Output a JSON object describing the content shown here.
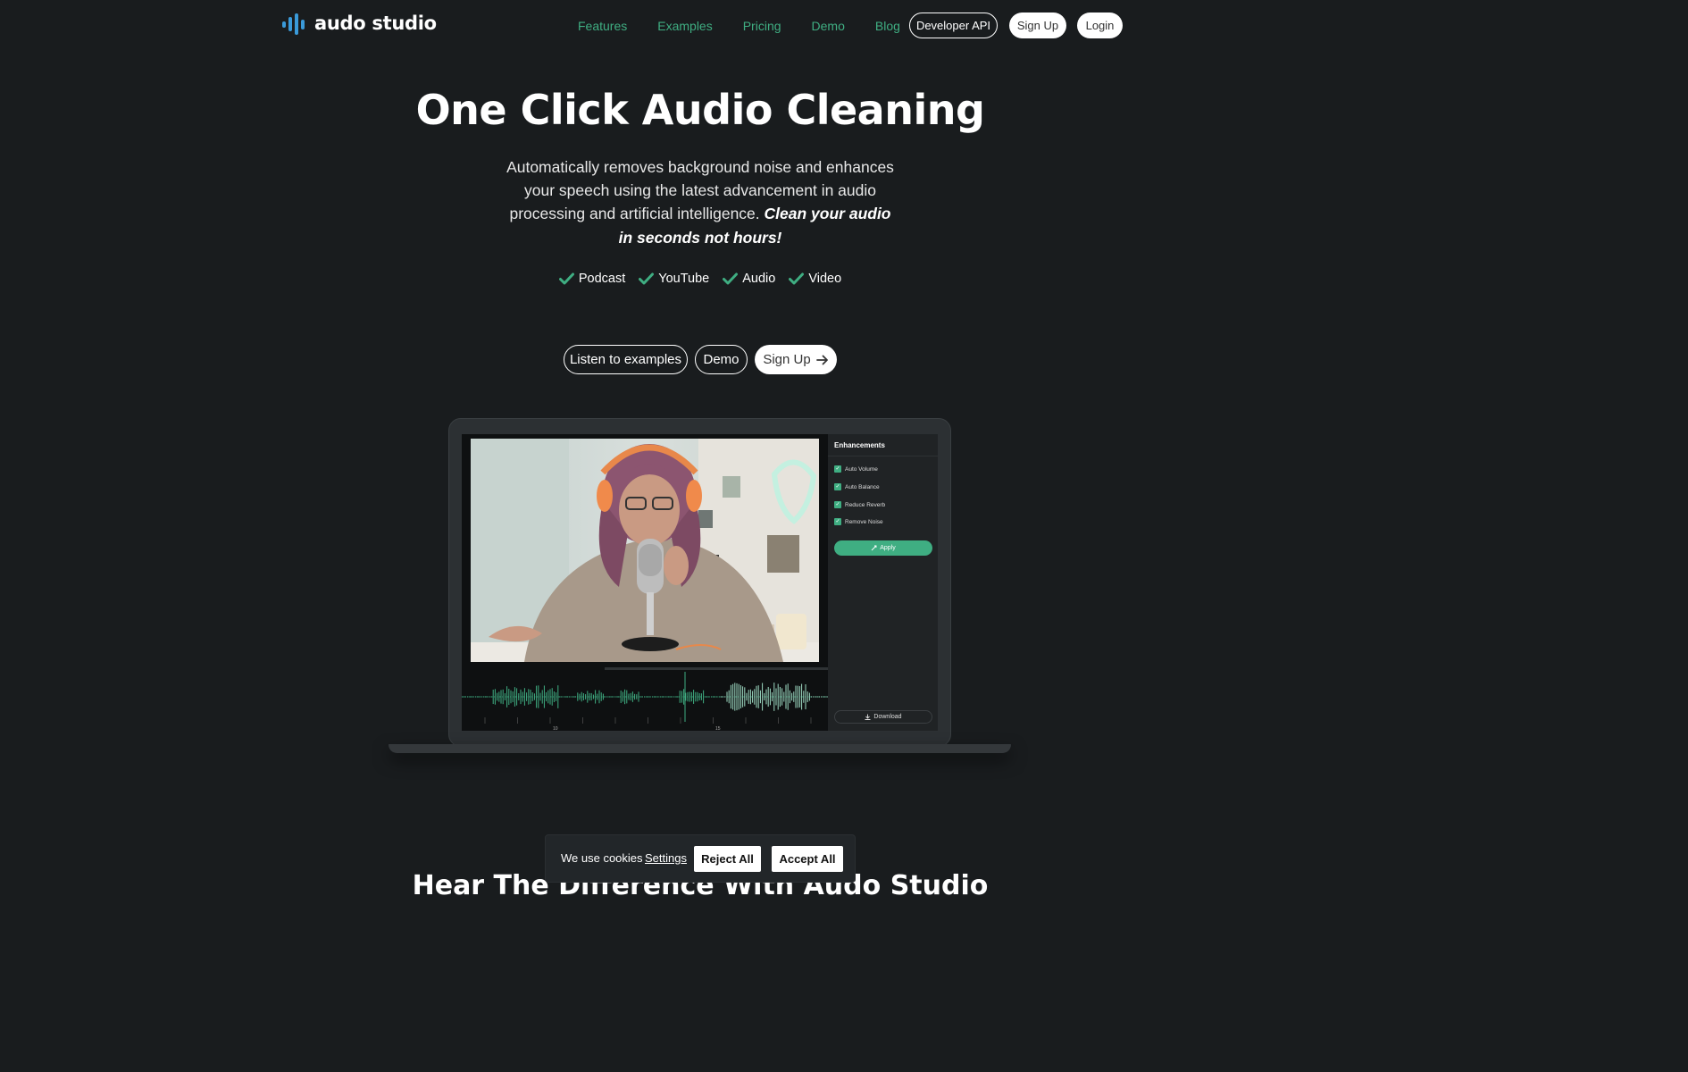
{
  "header": {
    "logo_text": "audo studio",
    "nav": [
      "Features",
      "Examples",
      "Pricing",
      "Demo",
      "Blog"
    ],
    "developer_api": "Developer API",
    "sign_up": "Sign Up",
    "login": "Login"
  },
  "hero": {
    "title": "One Click Audio Cleaning",
    "subtitle": "Automatically removes background noise and enhances your speech using the latest advancement in audio processing and artificial intelligence.",
    "subtitle_emphasis": "Clean your audio in seconds not hours!",
    "tags": [
      "Podcast",
      "YouTube",
      "Audio",
      "Video"
    ],
    "cta_examples": "Listen to examples",
    "cta_demo": "Demo",
    "cta_signup": "Sign Up"
  },
  "app_preview": {
    "panel_title": "Enhancements",
    "options": [
      "Auto Volume",
      "Auto Balance",
      "Reduce Reverb",
      "Remove Noise"
    ],
    "apply_label": "Apply",
    "download_label": "Download",
    "timeline_labels": [
      "10",
      "15"
    ]
  },
  "next_section": {
    "title": "Hear The Difference With Audo Studio"
  },
  "cookie_banner": {
    "text": "We use cookies",
    "settings": "Settings",
    "reject": "Reject All",
    "accept": "Accept All"
  },
  "colors": {
    "accent": "#3fae82",
    "background": "#191c1e",
    "logo_blue": "#3a9ad9"
  }
}
